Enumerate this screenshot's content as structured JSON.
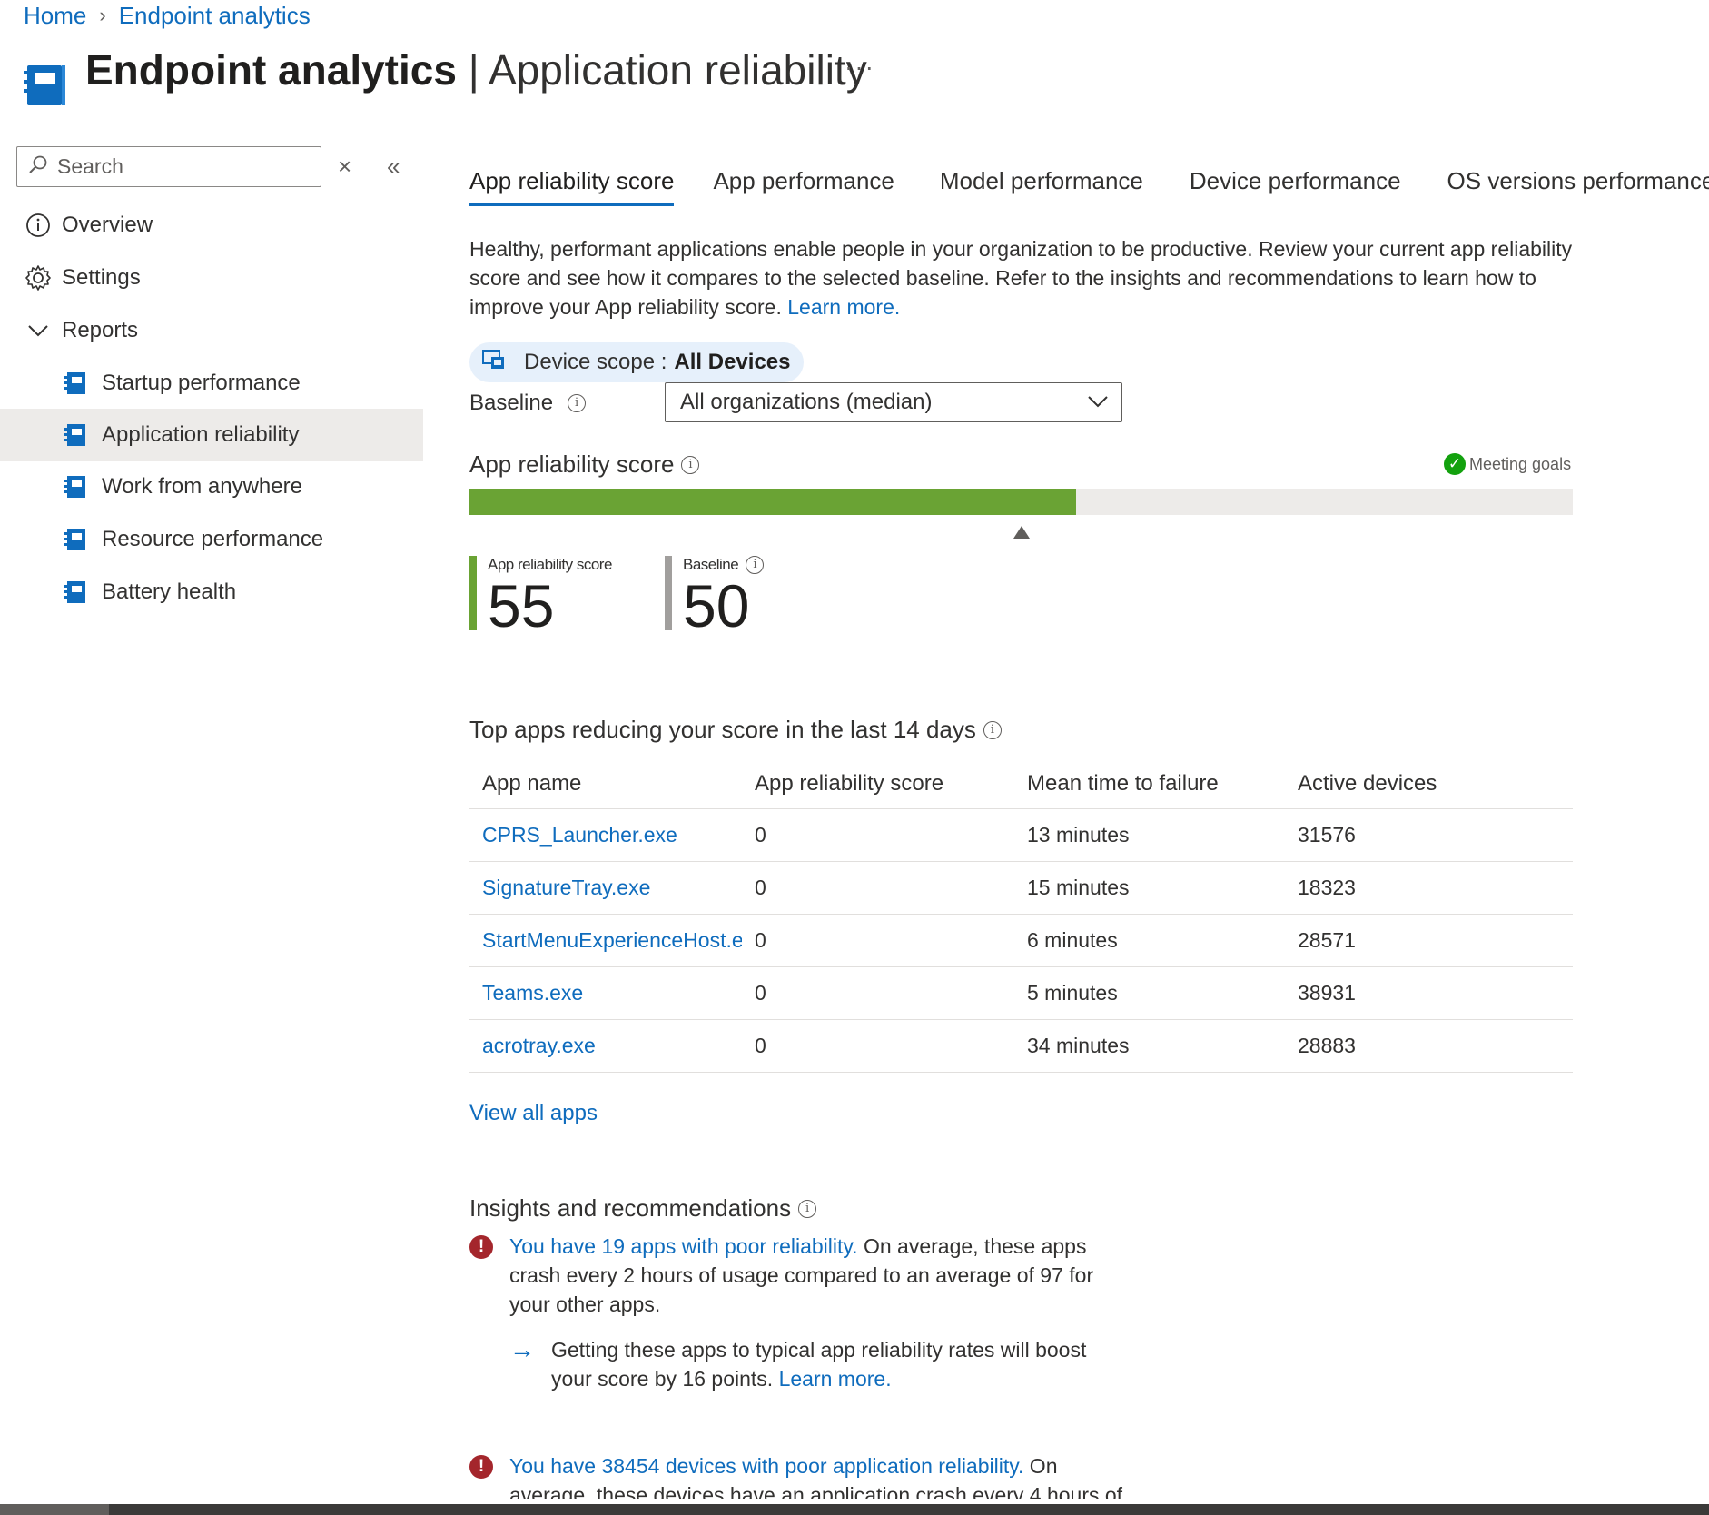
{
  "breadcrumb": {
    "home": "Home",
    "current": "Endpoint analytics"
  },
  "header": {
    "title_strong": "Endpoint analytics",
    "separator": " | ",
    "title_rest": "Application reliability",
    "more": "···"
  },
  "sidebar": {
    "search_placeholder": "Search",
    "clear": "×",
    "collapse": "«",
    "items": [
      {
        "label": "Overview",
        "icon": "info-icon"
      },
      {
        "label": "Settings",
        "icon": "gear-icon"
      },
      {
        "label": "Reports",
        "icon": "chevron-down-icon"
      },
      {
        "label": "Startup performance",
        "icon": "report-icon"
      },
      {
        "label": "Application reliability",
        "icon": "report-icon",
        "active": true
      },
      {
        "label": "Work from anywhere",
        "icon": "report-icon"
      },
      {
        "label": "Resource performance",
        "icon": "report-icon"
      },
      {
        "label": "Battery health",
        "icon": "report-icon"
      }
    ]
  },
  "tabs": [
    "App reliability score",
    "App performance",
    "Model performance",
    "Device performance",
    "OS versions performance"
  ],
  "description": {
    "text": "Healthy, performant applications enable people in your organization to be productive. Review your current app reliability score and see how it compares to the selected baseline. Refer to the insights and recommendations to learn how to improve your App reliability score. ",
    "link": "Learn more."
  },
  "scope": {
    "label": "Device scope :",
    "value": "All Devices"
  },
  "baseline": {
    "label": "Baseline",
    "selected": "All organizations (median)"
  },
  "score_section": {
    "title": "App reliability score",
    "goal_status": "Meeting goals",
    "score_fraction": 0.55,
    "baseline_fraction": 0.5,
    "score_label": "App reliability score",
    "score_value": "55",
    "baseline_label": "Baseline",
    "baseline_value": "50",
    "colors": {
      "score": "#6aa334",
      "baseline": "#a19f9d",
      "track": "#edebe9"
    }
  },
  "top_apps": {
    "title": "Top apps reducing your score in the last 14 days",
    "columns": [
      "App name",
      "App reliability score",
      "Mean time to failure",
      "Active devices"
    ],
    "rows": [
      [
        "CPRS_Launcher.exe",
        "0",
        "13 minutes",
        "31576"
      ],
      [
        "SignatureTray.exe",
        "0",
        "15 minutes",
        "18323"
      ],
      [
        "StartMenuExperienceHost.e",
        "0",
        "6 minutes",
        "28571"
      ],
      [
        "Teams.exe",
        "0",
        "5 minutes",
        "38931"
      ],
      [
        "acrotray.exe",
        "0",
        "34 minutes",
        "28883"
      ]
    ],
    "view_all": "View all apps"
  },
  "insights": {
    "title": "Insights and recommendations",
    "items": [
      {
        "link": "You have 19 apps with poor reliability.",
        "text": " On average, these apps crash every 2 hours of usage compared to an average of 97 for your other apps.",
        "recommendation": "Getting these apps to typical app reliability rates will boost your score by 16 points. ",
        "recommendation_link": "Learn more."
      },
      {
        "link": "You have 38454 devices with poor application reliability.",
        "text": " On average, these devices have an application crash every 4 hours of"
      }
    ]
  }
}
